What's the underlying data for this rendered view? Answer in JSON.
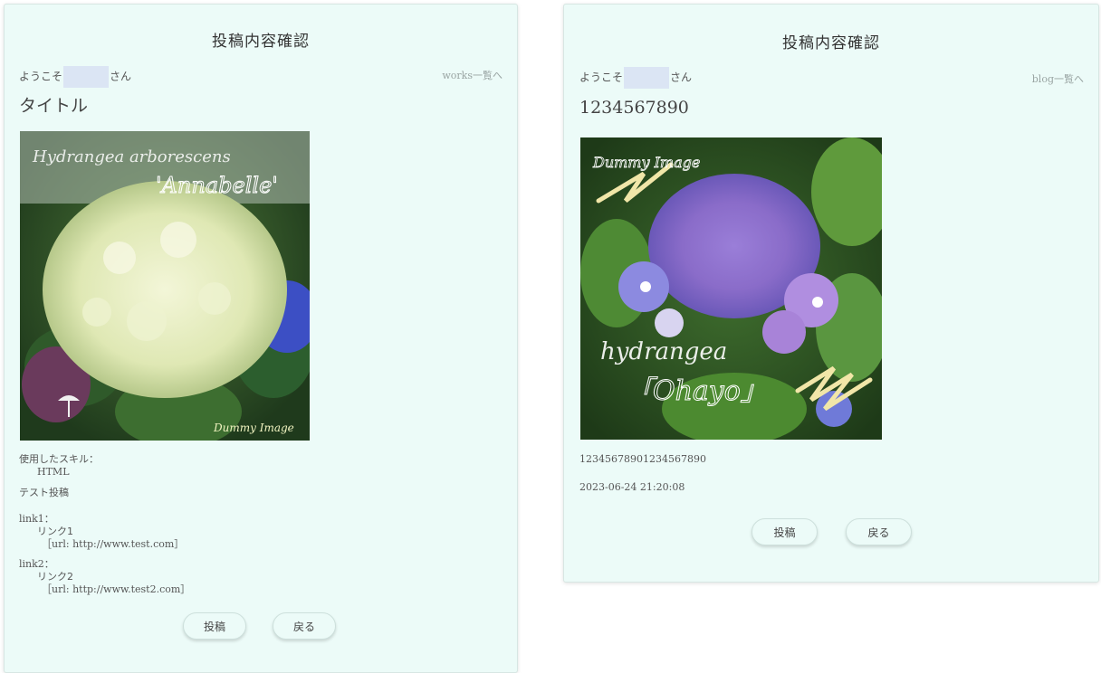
{
  "left": {
    "heading": "投稿内容確認",
    "welcome_prefix": "ようこそ",
    "welcome_suffix": "さん",
    "nav_link": "works一覧へ",
    "title": "タイトル",
    "image_text_1": "Hydrangea arborescens",
    "image_text_2": "'Annabelle'",
    "image_text_3": "Dummy Image",
    "skill_label": "使用したスキル：",
    "skill_value": "HTML",
    "body_text": "テスト投稿",
    "link1_label": "link1：",
    "link1_name": "リンク1",
    "link1_url": "［url: http://www.test.com］",
    "link2_label": "link2：",
    "link2_name": "リンク2",
    "link2_url": "［url: http://www.test2.com］",
    "submit_label": "投稿",
    "back_label": "戻る"
  },
  "right": {
    "heading": "投稿内容確認",
    "welcome_prefix": "ようこそ",
    "welcome_suffix": "さん",
    "nav_link": "blog一覧へ",
    "title": "1234567890",
    "image_text_1": "Dummy Image",
    "image_text_2": "hydrangea",
    "image_text_3": "「Ohayo」",
    "body_text": "12345678901234567890",
    "timestamp": "2023-06-24 21:20:08",
    "submit_label": "投稿",
    "back_label": "戻る"
  }
}
